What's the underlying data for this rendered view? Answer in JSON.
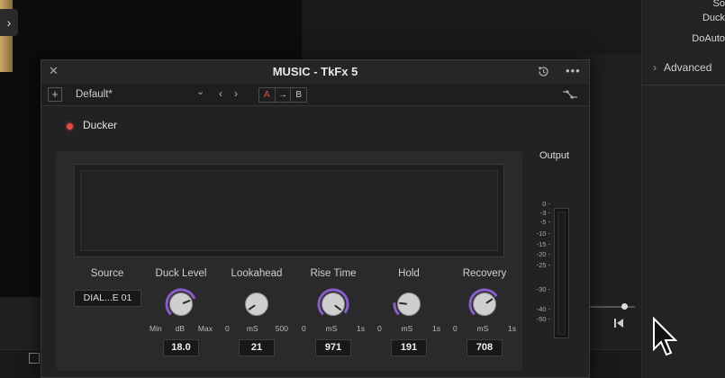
{
  "background": {
    "inspector_items": [
      "So",
      "Duck",
      "DoAuto"
    ],
    "advanced_label": "Advanced",
    "expand_glyph": "›"
  },
  "plugin": {
    "title": "MUSIC - TkFx 5",
    "preset": "Default*",
    "ab": {
      "a": "A",
      "arrow": "→",
      "b": "B"
    },
    "effect_name": "Ducker",
    "effect_enabled": true,
    "source": {
      "label": "Source",
      "value": "DIAL...E 01"
    },
    "controls": [
      {
        "label": "Duck Level",
        "scale": [
          "Min",
          "dB",
          "Max"
        ],
        "value": "18.0",
        "knob_turn": 0.75,
        "accent": true
      },
      {
        "label": "Lookahead",
        "scale": [
          "0",
          "mS",
          "500"
        ],
        "value": "21",
        "knob_turn": 0.04,
        "accent": false
      },
      {
        "label": "Rise Time",
        "scale": [
          "0",
          "mS",
          "1s"
        ],
        "value": "971",
        "knob_turn": 0.97,
        "accent": true
      },
      {
        "label": "Hold",
        "scale": [
          "0",
          "mS",
          "1s"
        ],
        "value": "191",
        "knob_turn": 0.19,
        "accent": true
      },
      {
        "label": "Recovery",
        "scale": [
          "0",
          "mS",
          "1s"
        ],
        "value": "708",
        "knob_turn": 0.71,
        "accent": true
      }
    ],
    "output": {
      "label": "Output",
      "ticks": [
        "0",
        "-3",
        "-5",
        "-10",
        "-15",
        "-20",
        "-25",
        "-30",
        "-40",
        "-50"
      ]
    }
  },
  "colors": {
    "accent": "#8a5cc9",
    "enable_dot": "#e14b45"
  }
}
